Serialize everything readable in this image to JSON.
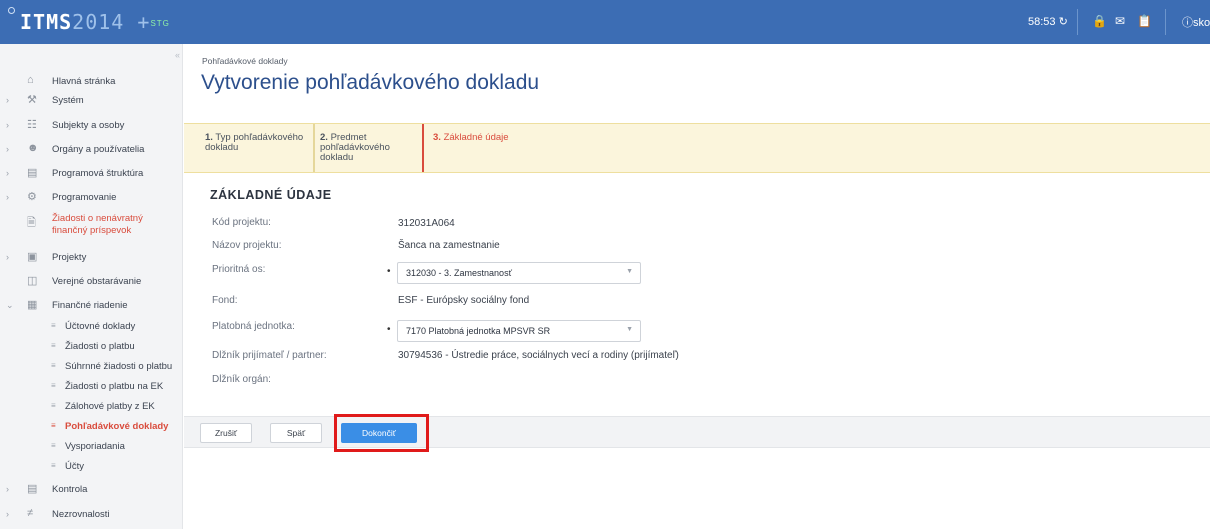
{
  "topbar": {
    "logo_bold": "ITMS",
    "logo_year": "2014",
    "logo_plus": "+",
    "logo_env": "STG",
    "timer": "58:53",
    "user_label": "skol",
    "colors": {
      "bar": "#3c6db4"
    }
  },
  "sidebar": {
    "collapse_icon": "«",
    "items": [
      {
        "label": "Hlavná stránka",
        "icon": "home-icon"
      },
      {
        "label": "Systém",
        "icon": "wrench-icon"
      },
      {
        "label": "Subjekty a osoby",
        "icon": "people-icon"
      },
      {
        "label": "Orgány a používatelia",
        "icon": "users-icon"
      },
      {
        "label": "Programová štruktúra",
        "icon": "structure-icon"
      },
      {
        "label": "Programovanie",
        "icon": "gear-icon"
      },
      {
        "label": "Žiadosti o nenávratný finančný príspevok",
        "icon": "document-icon"
      },
      {
        "label": "Projekty",
        "icon": "folder-icon"
      },
      {
        "label": "Verejné obstarávanie",
        "icon": "briefcase-icon"
      },
      {
        "label": "Finančné riadenie",
        "icon": "finance-icon"
      },
      {
        "label": "Kontrola",
        "icon": "checklist-icon"
      },
      {
        "label": "Nezrovnalosti",
        "icon": "not-equal-icon"
      }
    ],
    "sub_items": [
      "Účtovné doklady",
      "Žiadosti o platbu",
      "Súhrnné žiadosti o platbu",
      "Žiadosti o platbu na EK",
      "Zálohové platby z EK",
      "Pohľadávkové doklady",
      "Vysporiadania",
      "Účty"
    ]
  },
  "main": {
    "breadcrumb": "Pohľadávkové doklady",
    "title": "Vytvorenie pohľadávkového dokladu",
    "steps": [
      {
        "num": "1.",
        "label": "Typ pohľadávkového dokladu"
      },
      {
        "num": "2.",
        "label": "Predmet pohľadávkového dokladu"
      },
      {
        "num": "3.",
        "label": "Základné údaje"
      }
    ],
    "section_title": "ZÁKLADNÉ ÚDAJE",
    "fields": {
      "kod_label": "Kód projektu:",
      "kod_value": "312031A064",
      "nazov_label": "Názov projektu:",
      "nazov_value": "Šanca na zamestnanie",
      "os_label": "Prioritná os:",
      "os_value": "312030 - 3. Zamestnanosť",
      "fond_label": "Fond:",
      "fond_value": "ESF - Európsky sociálny fond",
      "pj_label": "Platobná jednotka:",
      "pj_value": "7170 Platobná jednotka MPSVR SR",
      "dlznik_label": "Dlžník prijímateľ / partner:",
      "dlznik_value": "30794536 - Ústredie práce, sociálnych vecí a rodiny (prijímateľ)",
      "organ_label": "Dlžník orgán:",
      "required_mark": "•"
    },
    "buttons": {
      "cancel": "Zrušiť",
      "back": "Späť",
      "finish": "Dokončiť"
    },
    "colors": {
      "title": "#2c4f8c",
      "accent_red": "#d94c3d",
      "primary_button": "#3a8ee6",
      "highlight": "#e01a1a"
    }
  }
}
